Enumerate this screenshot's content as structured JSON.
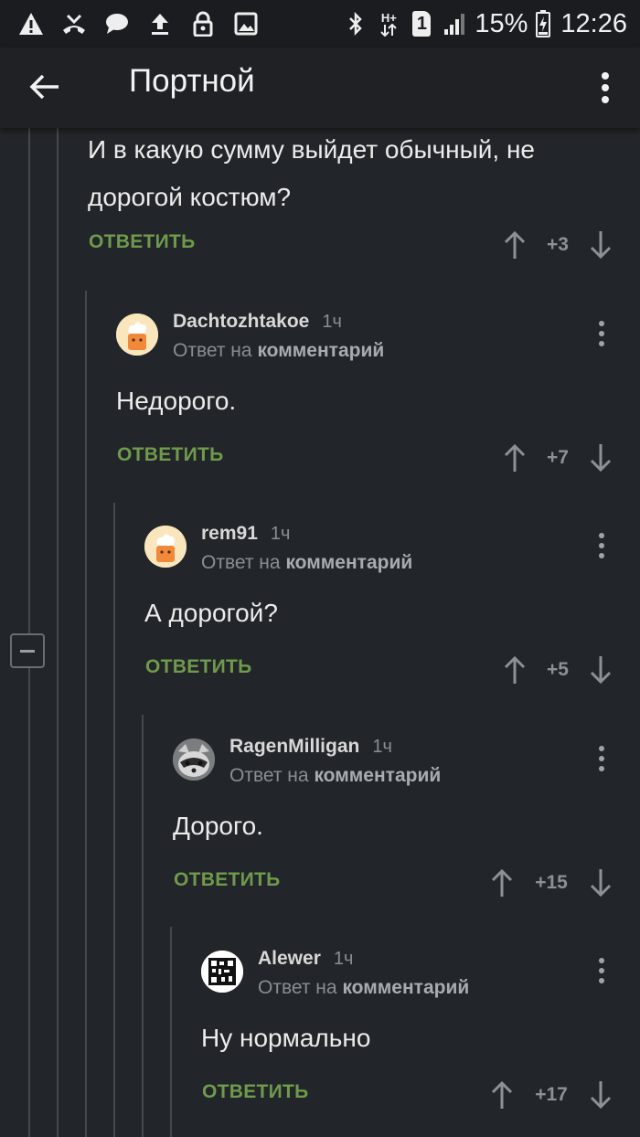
{
  "status_bar": {
    "battery_percent": "15%",
    "time": "12:26",
    "network_label": "H+",
    "sim_label": "1",
    "left_icons": [
      "warning-icon",
      "missed-call-icon",
      "chat-icon",
      "upload-icon",
      "lock-icon",
      "image-icon"
    ],
    "right_icons": [
      "bluetooth-icon",
      "data-arrows-icon",
      "sim-icon",
      "signal-icon",
      "battery-charging-icon"
    ]
  },
  "app_bar": {
    "title": "Портной",
    "back_icon": "arrow-back-icon",
    "menu_icon": "more-vert-icon"
  },
  "colors": {
    "background": "#222529",
    "reply_green": "#6f9a4c",
    "thread_line": "#45494e"
  },
  "comments": [
    {
      "text": "И в какую сумму выйдет обычный, не дорогой костюм?",
      "reply_label": "ОТВЕТИТЬ",
      "score": "+3"
    },
    {
      "author": "Dachtozhtakoe",
      "time": "1ч",
      "reply_prefix": "Ответ на",
      "reply_target": "комментарий",
      "avatar": "default-chef-avatar",
      "text": "Недорого.",
      "reply_label": "ОТВЕТИТЬ",
      "score": "+7"
    },
    {
      "author": "rem91",
      "time": "1ч",
      "reply_prefix": "Ответ на",
      "reply_target": "комментарий",
      "avatar": "default-chef-avatar",
      "text": "А дорогой?",
      "reply_label": "ОТВЕТИТЬ",
      "score": "+5"
    },
    {
      "author": "RagenMilligan",
      "time": "1ч",
      "reply_prefix": "Ответ на",
      "reply_target": "комментарий",
      "avatar": "raccoon-avatar",
      "text": "Дорого.",
      "reply_label": "ОТВЕТИТЬ",
      "score": "+15"
    },
    {
      "author": "Alewer",
      "time": "1ч",
      "reply_prefix": "Ответ на",
      "reply_target": "комментарий",
      "avatar": "qr-code-avatar",
      "text": "Ну нормально",
      "reply_label": "ОТВЕТИТЬ",
      "score": "+17"
    }
  ]
}
